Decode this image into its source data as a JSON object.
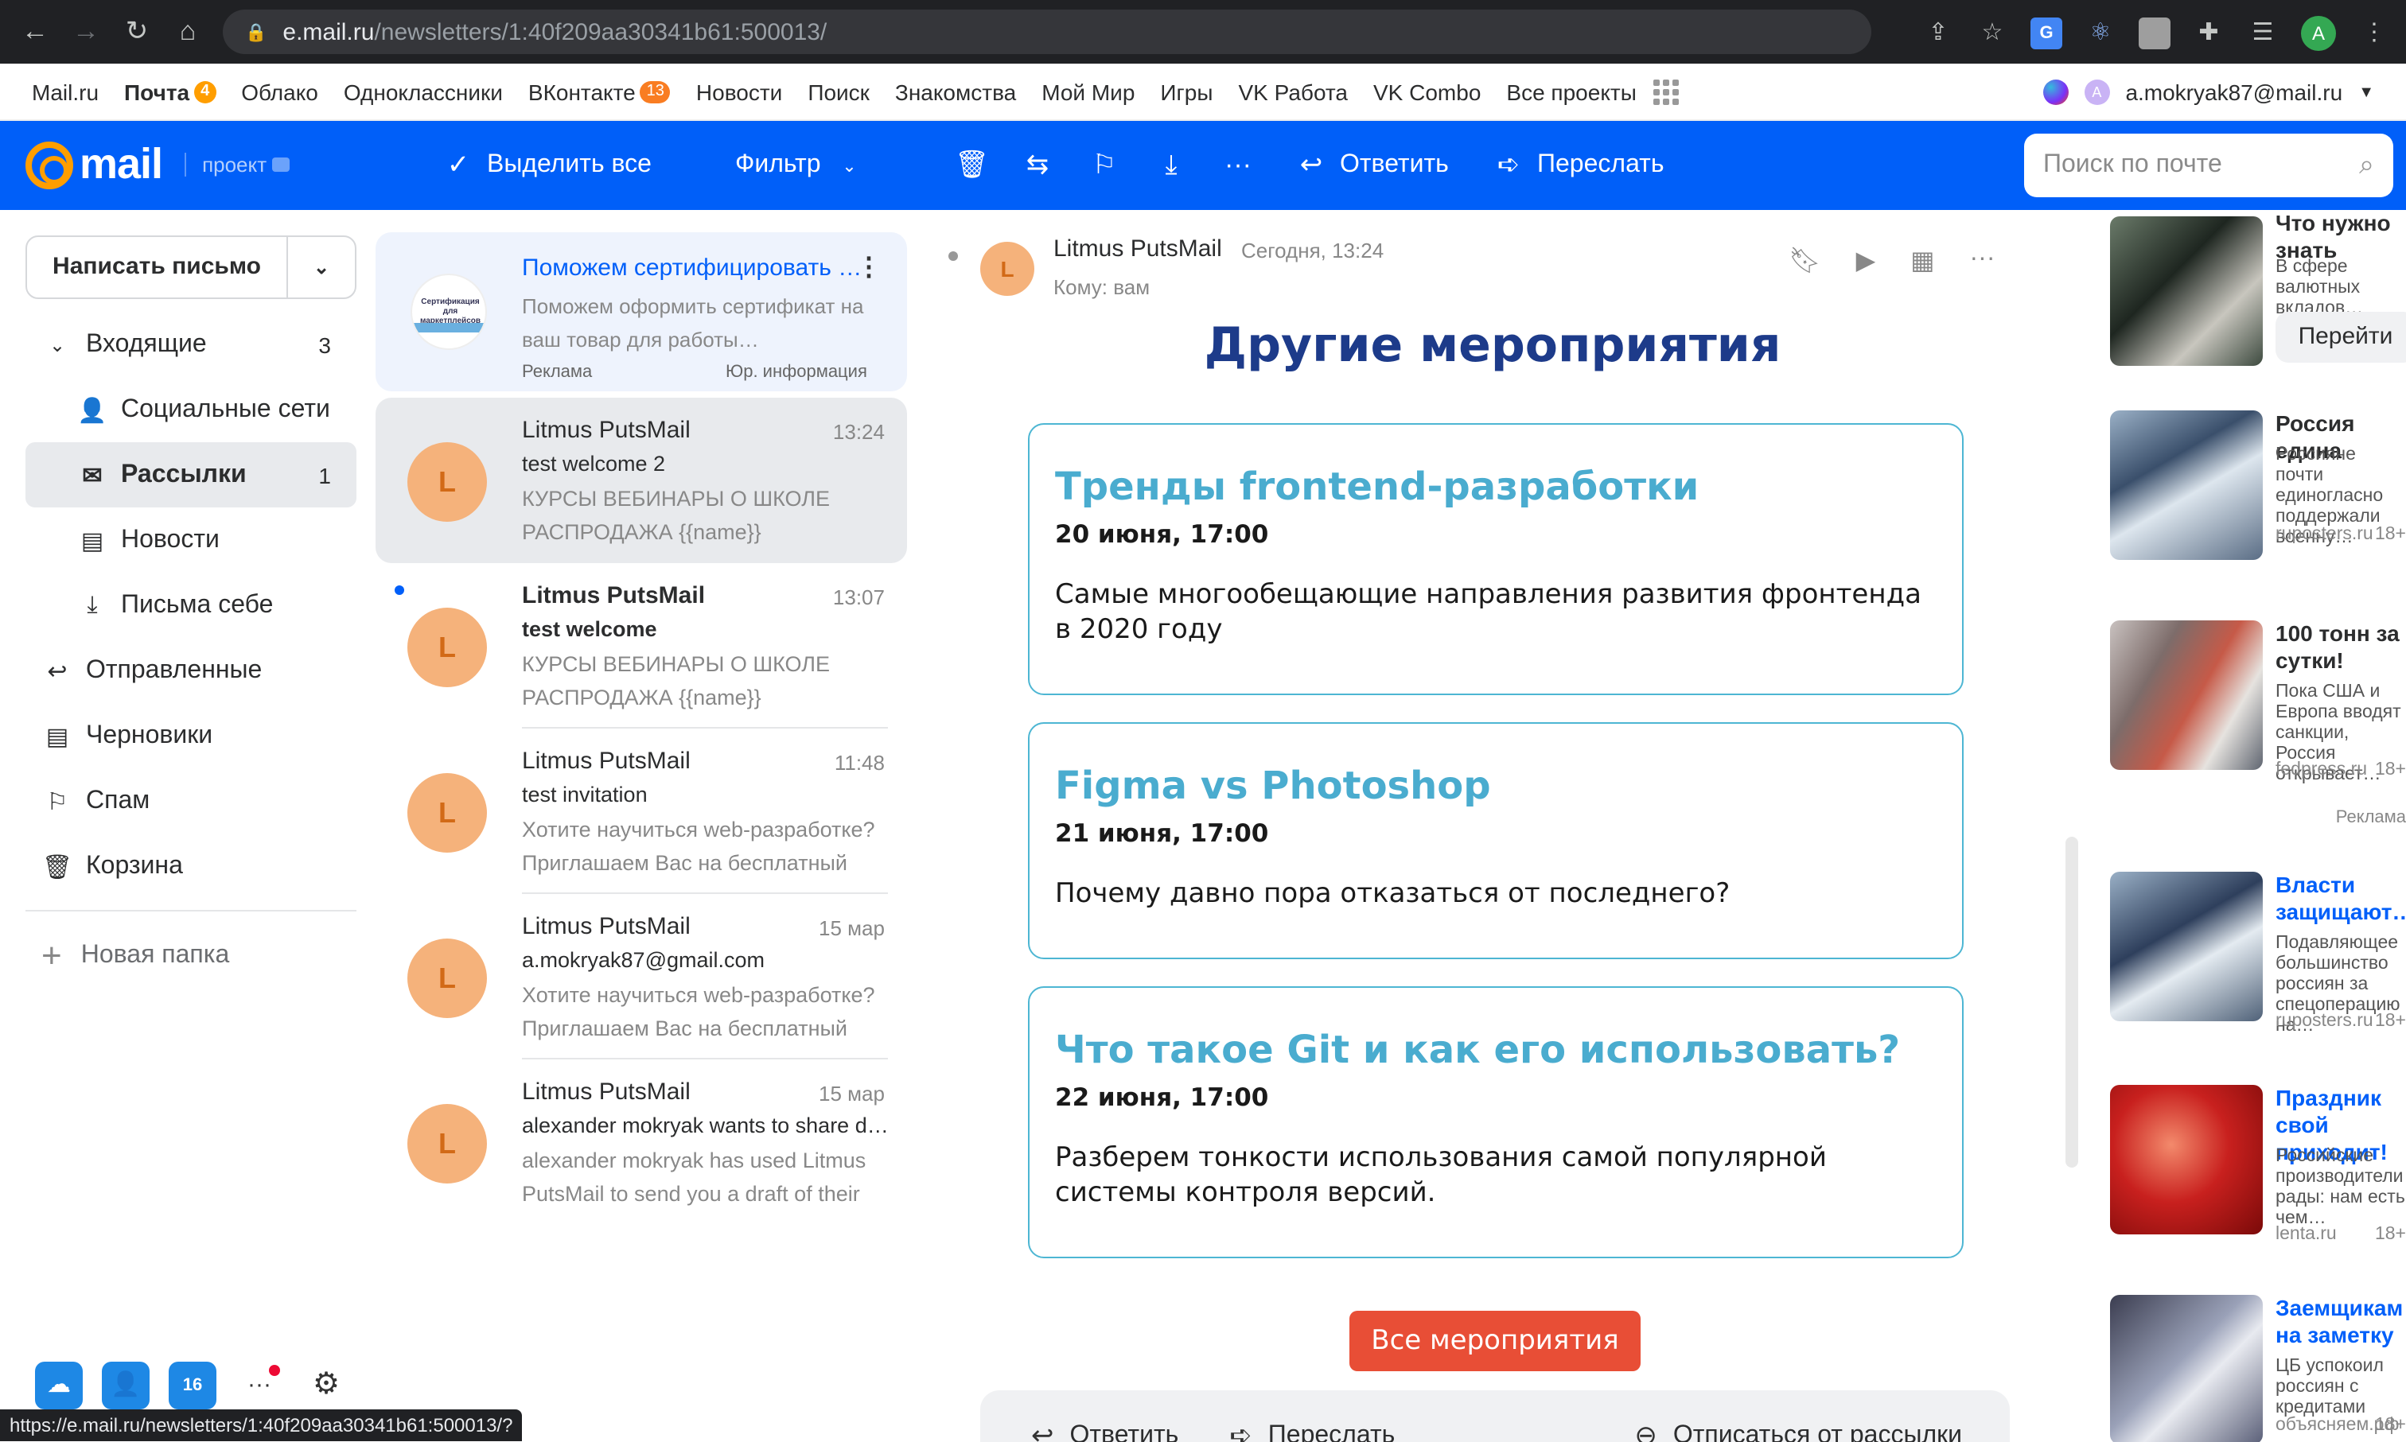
{
  "browser": {
    "url_host": "e.mail.ru",
    "url_path": "/newsletters/1:40f209aa30341b61:500013/",
    "profile_initial": "A",
    "status_url": "https://e.mail.ru/newsletters/1:40f209aa30341b61:500013/?"
  },
  "portal": {
    "links": [
      {
        "label": "Mail.ru"
      },
      {
        "label": "Почта",
        "badge": "4"
      },
      {
        "label": "Облако"
      },
      {
        "label": "Одноклассники"
      },
      {
        "label": "ВКонтакте",
        "badge": "13"
      },
      {
        "label": "Новости"
      },
      {
        "label": "Поиск"
      },
      {
        "label": "Знакомства"
      },
      {
        "label": "Мой Мир"
      },
      {
        "label": "Игры"
      },
      {
        "label": "VK Работа"
      },
      {
        "label": "VK Combo"
      },
      {
        "label": "Все проекты"
      }
    ],
    "user_email": "a.mokryak87@mail.ru",
    "user_initial": "A"
  },
  "toolbar": {
    "logo_text": "mail",
    "project_label": "проект",
    "select_all": "Выделить все",
    "filter": "Фильтр",
    "reply": "Ответить",
    "forward": "Переслать",
    "search_placeholder": "Поиск по почте"
  },
  "sidebar": {
    "compose": "Написать письмо",
    "items": [
      {
        "label": "Входящие",
        "count": "3"
      },
      {
        "label": "Социальные сети"
      },
      {
        "label": "Рассылки",
        "count": "1"
      },
      {
        "label": "Новости"
      },
      {
        "label": "Письма себе"
      },
      {
        "label": "Отправленные"
      },
      {
        "label": "Черновики"
      },
      {
        "label": "Спам"
      },
      {
        "label": "Корзина"
      }
    ],
    "new_folder": "Новая папка",
    "calendar_day": "16"
  },
  "ad_message": {
    "title": "Поможем сертифицировать товар для маркетплейсов",
    "desc": "Поможем оформить сертификат на ваш товар для работы…",
    "label": "Реклама",
    "legal": "Юр. информация",
    "image_text": "Сертификация для маркетплейсов"
  },
  "messages": [
    {
      "from": "Litmus PutsMail",
      "time": "13:24",
      "subject": "test welcome 2",
      "preview": "КУРСЫ ВЕБИНАРЫ О ШКОЛЕ РАСПРОДАЖА {{name}}",
      "initial": "L"
    },
    {
      "from": "Litmus PutsMail",
      "time": "13:07",
      "subject": "test welcome",
      "preview": "КУРСЫ ВЕБИНАРЫ О ШКОЛЕ РАСПРОДАЖА {{name}}",
      "initial": "L"
    },
    {
      "from": "Litmus PutsMail",
      "time": "11:48",
      "subject": "test invitation",
      "preview": "Хотите научиться web-разработке? Приглашаем Вас на бесплатный",
      "initial": "L"
    },
    {
      "from": "Litmus PutsMail",
      "time": "15 мар",
      "subject": "a.mokryak87@gmail.com",
      "preview": "Хотите научиться web-разработке? Приглашаем Вас на бесплатный",
      "initial": "L"
    },
    {
      "from": "Litmus PutsMail",
      "time": "15 мар",
      "subject": "alexander mokryak wants to share d…",
      "preview": "alexander mokryak has used Litmus PutsMail to send you a draft of their",
      "initial": "L"
    }
  ],
  "reading": {
    "from": "Litmus PutsMail",
    "date": "Сегодня, 13:24",
    "to": "Кому: вам",
    "initial": "L",
    "heading": "Другие мероприятия",
    "events": [
      {
        "title": "Тренды frontend-разработки",
        "date": "20 июня, 17:00",
        "text": "Самые многообещающие направления развития фронтенда в 2020 году"
      },
      {
        "title": "Figma vs Photoshop",
        "date": "21 июня, 17:00",
        "text": "Почему давно пора отказаться от последнего?"
      },
      {
        "title": "Что такое Git и как его использовать?",
        "date": "22 июня, 17:00",
        "text": "Разберем тонкости использования самой популярной системы контроля версий."
      }
    ],
    "all_events_button": "Все мероприятия",
    "footer": {
      "reply": "Ответить",
      "forward": "Переслать",
      "unsubscribe": "Отписаться от рассылки"
    }
  },
  "ads": {
    "top": {
      "title": "Что нужно знать",
      "desc": "В сфере валютных вкладов…",
      "button": "Перейти"
    },
    "items": [
      {
        "title": "Россия едина",
        "desc": "Россияне почти единогласно поддержали военну…",
        "source": "ruposters.ru",
        "age": "18+"
      },
      {
        "title": "100 тонн за сутки!",
        "desc": "Пока США и Европа вводят санкции, Россия открывает…",
        "source": "fedpress.ru",
        "age": "18+"
      },
      {
        "title": "Власти защищают…",
        "desc": "Подавляющее большинство россиян за спецоперацию на…",
        "source": "ruposters.ru",
        "age": "18+"
      },
      {
        "title": "Праздник свой приходит!",
        "desc": "Российские производители рады: нам есть чем…",
        "source": "lenta.ru",
        "age": "18+"
      },
      {
        "title": "Заемщикам на заметку",
        "desc": "ЦБ успокоил россиян с кредитами",
        "source": "объясняем.рф",
        "age": "18+"
      }
    ],
    "label": "Реклама"
  },
  "colors": {
    "brand_blue": "#005ff9",
    "accent_orange": "#ff9e00",
    "event_title": "#4aaccf",
    "heading": "#1d3b8a",
    "cta_red": "#e84e36"
  }
}
